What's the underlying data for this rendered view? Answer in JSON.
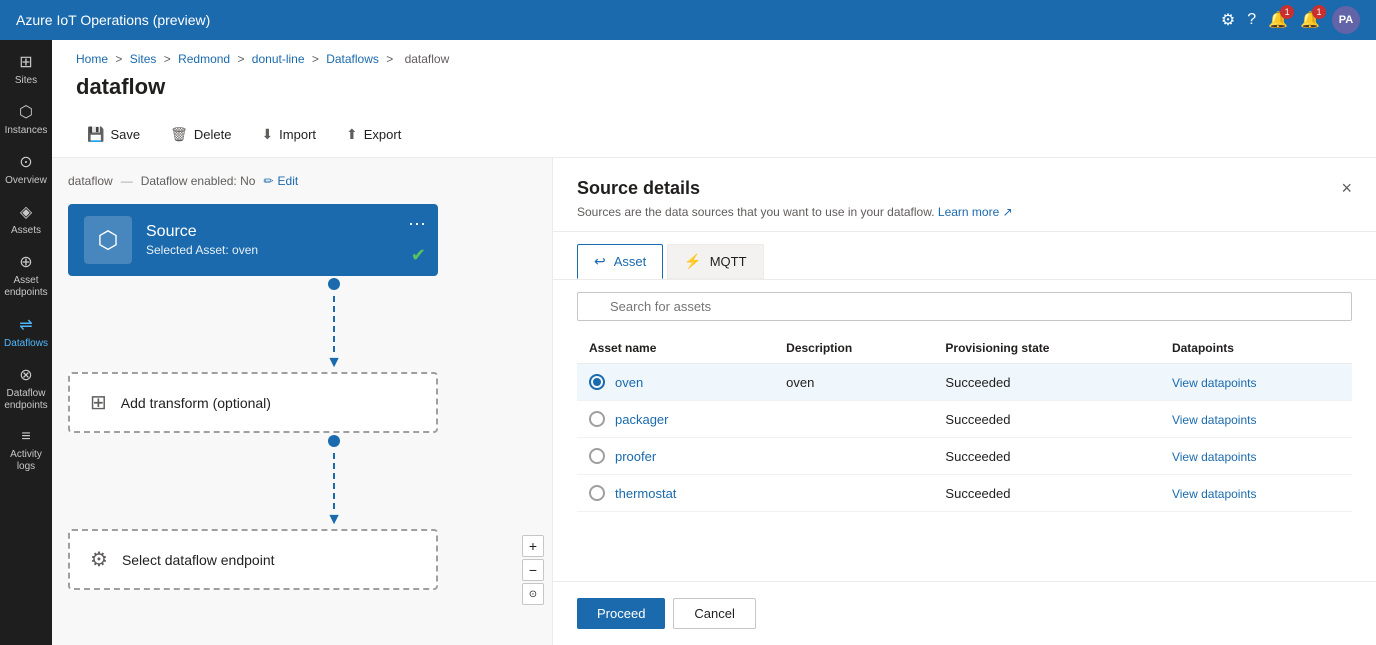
{
  "app": {
    "title": "Azure IoT Operations (preview)"
  },
  "topnav": {
    "title": "Azure IoT Operations (preview)",
    "notifications_count": "1",
    "alerts_count": "1",
    "avatar_initials": "PA"
  },
  "sidebar": {
    "items": [
      {
        "id": "sites",
        "label": "Sites",
        "icon": "⊞"
      },
      {
        "id": "instances",
        "label": "Instances",
        "icon": "⬡"
      },
      {
        "id": "overview",
        "label": "Overview",
        "icon": "⊙"
      },
      {
        "id": "assets",
        "label": "Assets",
        "icon": "◈"
      },
      {
        "id": "asset-endpoints",
        "label": "Asset endpoints",
        "icon": "⊕"
      },
      {
        "id": "dataflows",
        "label": "Dataflows",
        "icon": "⇌",
        "active": true
      },
      {
        "id": "dataflow-endpoints",
        "label": "Dataflow endpoints",
        "icon": "⊗"
      },
      {
        "id": "activity-logs",
        "label": "Activity logs",
        "icon": "≡"
      }
    ]
  },
  "breadcrumb": {
    "items": [
      "Home",
      "Sites",
      "Redmond",
      "donut-line",
      "Dataflows",
      "dataflow"
    ]
  },
  "page": {
    "title": "dataflow"
  },
  "toolbar": {
    "save_label": "Save",
    "delete_label": "Delete",
    "import_label": "Import",
    "export_label": "Export"
  },
  "flow_breadcrumb": {
    "name": "dataflow",
    "separator": "—",
    "enabled_label": "Dataflow enabled: No",
    "edit_label": "Edit"
  },
  "source_card": {
    "title": "Source",
    "subtitle": "Selected Asset: oven",
    "menu_icon": "⋯"
  },
  "transform_card": {
    "label": "Add transform (optional)"
  },
  "endpoint_card": {
    "label": "Select dataflow endpoint"
  },
  "details_panel": {
    "title": "Source details",
    "subtitle": "Sources are the data sources that you want to use in your dataflow.",
    "learn_more": "Learn more",
    "close_label": "×",
    "tabs": [
      {
        "id": "asset",
        "label": "Asset",
        "active": true
      },
      {
        "id": "mqtt",
        "label": "MQTT",
        "active": false
      }
    ],
    "search_placeholder": "Search for assets",
    "table": {
      "columns": [
        "Asset name",
        "Description",
        "Provisioning state",
        "Datapoints"
      ],
      "rows": [
        {
          "name": "oven",
          "description": "oven",
          "state": "Succeeded",
          "datapoints": "View datapoints",
          "selected": true
        },
        {
          "name": "packager",
          "description": "",
          "state": "Succeeded",
          "datapoints": "View datapoints",
          "selected": false
        },
        {
          "name": "proofer",
          "description": "",
          "state": "Succeeded",
          "datapoints": "View datapoints",
          "selected": false
        },
        {
          "name": "thermostat",
          "description": "",
          "state": "Succeeded",
          "datapoints": "View datapoints",
          "selected": false
        }
      ]
    },
    "proceed_label": "Proceed",
    "cancel_label": "Cancel"
  }
}
